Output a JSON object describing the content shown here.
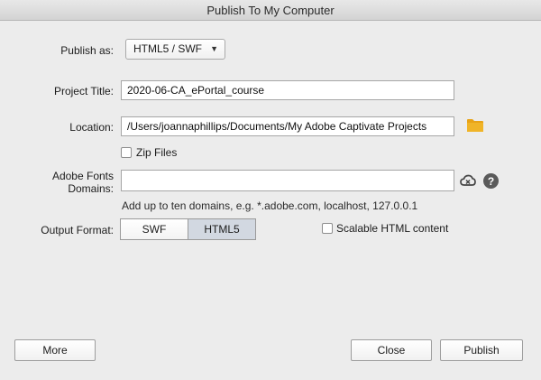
{
  "window": {
    "title": "Publish To My Computer"
  },
  "publish_as": {
    "label": "Publish as:",
    "value": "HTML5 / SWF"
  },
  "project_title": {
    "label": "Project Title:",
    "value": "2020-06-CA_ePortal_course"
  },
  "location": {
    "label": "Location:",
    "value": "/Users/joannaphillips/Documents/My Adobe Captivate Projects",
    "icon": "folder-icon"
  },
  "zip_files": {
    "label": "Zip Files",
    "checked": false
  },
  "fonts_domains": {
    "label": "Adobe Fonts Domains:",
    "value": "",
    "hint": "Add up to ten domains, e.g. *.adobe.com, localhost, 127.0.0.1",
    "icons": [
      "creative-cloud-icon",
      "help-icon"
    ]
  },
  "output_format": {
    "label": "Output Format:",
    "options": [
      "SWF",
      "HTML5"
    ],
    "selected": "HTML5"
  },
  "scalable_html": {
    "label": "Scalable HTML content",
    "checked": false
  },
  "buttons": {
    "more": "More",
    "close": "Close",
    "publish": "Publish"
  },
  "colors": {
    "folder": "#e8a317",
    "selected_segment": "#d2d8e1",
    "background": "#ececec"
  }
}
